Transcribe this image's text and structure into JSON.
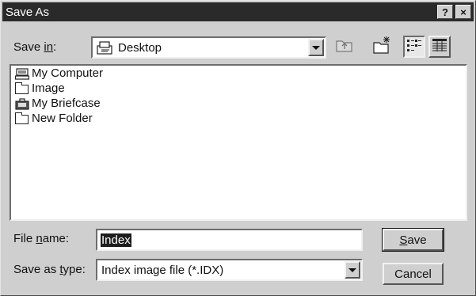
{
  "window": {
    "title": "Save As",
    "help_label": "?",
    "close_label": "×"
  },
  "save_in": {
    "label_prefix": "Save ",
    "label_underlined": "in",
    "label_suffix": ":",
    "value": "Desktop"
  },
  "toolbar": {
    "icons": [
      "up-one-level-icon",
      "create-new-folder-icon",
      "list-view-icon",
      "details-view-icon"
    ]
  },
  "file_list": {
    "items": [
      {
        "label": "My Computer",
        "icon": "computer-icon"
      },
      {
        "label": "Image",
        "icon": "folder-icon"
      },
      {
        "label": "My Briefcase",
        "icon": "briefcase-icon"
      },
      {
        "label": "New Folder",
        "icon": "folder-icon"
      }
    ]
  },
  "file_name": {
    "label_prefix": "File ",
    "label_underlined": "n",
    "label_suffix": "ame:",
    "value": "Index"
  },
  "save_as_type": {
    "label_prefix": "Save as ",
    "label_underlined": "t",
    "label_suffix": "ype:",
    "value": "Index image file (*.IDX)"
  },
  "buttons": {
    "save_underlined": "S",
    "save_rest": "ave",
    "cancel": "Cancel"
  },
  "colors": {
    "dialog_face": "#cfcfcf",
    "titlebar": "#2a2a2a",
    "selection": "#1e1e1e"
  }
}
